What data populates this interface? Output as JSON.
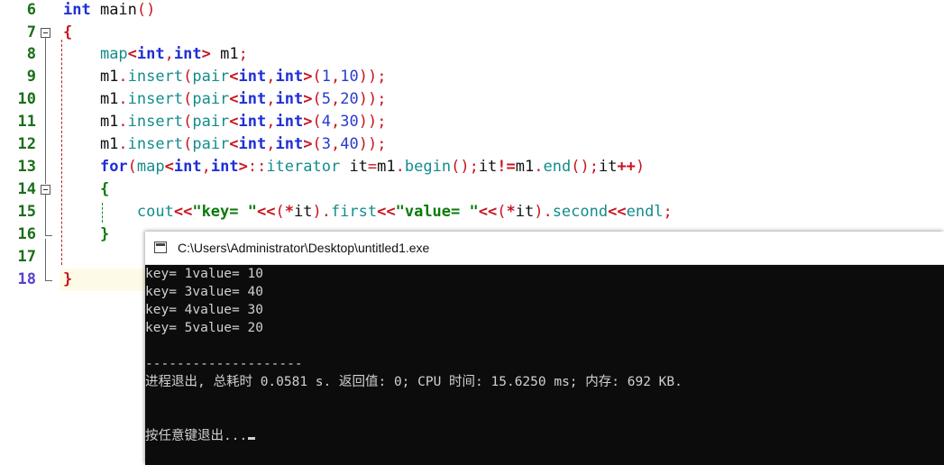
{
  "editor": {
    "line_numbers": [
      "6",
      "7",
      "8",
      "9",
      "10",
      "11",
      "12",
      "13",
      "14",
      "15",
      "16",
      "17",
      "18"
    ],
    "lines": {
      "l6": [
        {
          "c": "kw",
          "t": "int"
        },
        {
          "c": "pl",
          "t": " main"
        },
        {
          "c": "pu",
          "t": "()"
        }
      ],
      "l7": [
        {
          "c": "br",
          "t": "{"
        }
      ],
      "l8": [
        {
          "c": "pl",
          "t": "    "
        },
        {
          "c": "ty",
          "t": "map"
        },
        {
          "c": "op",
          "t": "<"
        },
        {
          "c": "kw",
          "t": "int"
        },
        {
          "c": "pu",
          "t": ","
        },
        {
          "c": "kw",
          "t": "int"
        },
        {
          "c": "op",
          "t": ">"
        },
        {
          "c": "pl",
          "t": " m1"
        },
        {
          "c": "pu",
          "t": ";"
        }
      ],
      "l9": [
        {
          "c": "pl",
          "t": "    m1"
        },
        {
          "c": "pu",
          "t": "."
        },
        {
          "c": "ty",
          "t": "insert"
        },
        {
          "c": "pu",
          "t": "("
        },
        {
          "c": "ty",
          "t": "pair"
        },
        {
          "c": "op",
          "t": "<"
        },
        {
          "c": "kw",
          "t": "int"
        },
        {
          "c": "pu",
          "t": ","
        },
        {
          "c": "kw",
          "t": "int"
        },
        {
          "c": "op",
          "t": ">"
        },
        {
          "c": "pu",
          "t": "("
        },
        {
          "c": "nm",
          "t": "1"
        },
        {
          "c": "pu",
          "t": ","
        },
        {
          "c": "nm",
          "t": "10"
        },
        {
          "c": "pu",
          "t": "));"
        }
      ],
      "l10": [
        {
          "c": "pl",
          "t": "    m1"
        },
        {
          "c": "pu",
          "t": "."
        },
        {
          "c": "ty",
          "t": "insert"
        },
        {
          "c": "pu",
          "t": "("
        },
        {
          "c": "ty",
          "t": "pair"
        },
        {
          "c": "op",
          "t": "<"
        },
        {
          "c": "kw",
          "t": "int"
        },
        {
          "c": "pu",
          "t": ","
        },
        {
          "c": "kw",
          "t": "int"
        },
        {
          "c": "op",
          "t": ">"
        },
        {
          "c": "pu",
          "t": "("
        },
        {
          "c": "nm",
          "t": "5"
        },
        {
          "c": "pu",
          "t": ","
        },
        {
          "c": "nm",
          "t": "20"
        },
        {
          "c": "pu",
          "t": "));"
        }
      ],
      "l11": [
        {
          "c": "pl",
          "t": "    m1"
        },
        {
          "c": "pu",
          "t": "."
        },
        {
          "c": "ty",
          "t": "insert"
        },
        {
          "c": "pu",
          "t": "("
        },
        {
          "c": "ty",
          "t": "pair"
        },
        {
          "c": "op",
          "t": "<"
        },
        {
          "c": "kw",
          "t": "int"
        },
        {
          "c": "pu",
          "t": ","
        },
        {
          "c": "kw",
          "t": "int"
        },
        {
          "c": "op",
          "t": ">"
        },
        {
          "c": "pu",
          "t": "("
        },
        {
          "c": "nm",
          "t": "4"
        },
        {
          "c": "pu",
          "t": ","
        },
        {
          "c": "nm",
          "t": "30"
        },
        {
          "c": "pu",
          "t": "));"
        }
      ],
      "l12": [
        {
          "c": "pl",
          "t": "    m1"
        },
        {
          "c": "pu",
          "t": "."
        },
        {
          "c": "ty",
          "t": "insert"
        },
        {
          "c": "pu",
          "t": "("
        },
        {
          "c": "ty",
          "t": "pair"
        },
        {
          "c": "op",
          "t": "<"
        },
        {
          "c": "kw",
          "t": "int"
        },
        {
          "c": "pu",
          "t": ","
        },
        {
          "c": "kw",
          "t": "int"
        },
        {
          "c": "op",
          "t": ">"
        },
        {
          "c": "pu",
          "t": "("
        },
        {
          "c": "nm",
          "t": "3"
        },
        {
          "c": "pu",
          "t": ","
        },
        {
          "c": "nm",
          "t": "40"
        },
        {
          "c": "pu",
          "t": "));"
        }
      ],
      "l13": [
        {
          "c": "pl",
          "t": "    "
        },
        {
          "c": "kw",
          "t": "for"
        },
        {
          "c": "pu",
          "t": "("
        },
        {
          "c": "ty",
          "t": "map"
        },
        {
          "c": "op",
          "t": "<"
        },
        {
          "c": "kw",
          "t": "int"
        },
        {
          "c": "pu",
          "t": ","
        },
        {
          "c": "kw",
          "t": "int"
        },
        {
          "c": "op",
          "t": ">"
        },
        {
          "c": "pu",
          "t": "::"
        },
        {
          "c": "ty",
          "t": "iterator"
        },
        {
          "c": "pl",
          "t": " it"
        },
        {
          "c": "pu",
          "t": "="
        },
        {
          "c": "pl",
          "t": "m1"
        },
        {
          "c": "pu",
          "t": "."
        },
        {
          "c": "ty",
          "t": "begin"
        },
        {
          "c": "pu",
          "t": "();"
        },
        {
          "c": "pl",
          "t": "it"
        },
        {
          "c": "op",
          "t": "!="
        },
        {
          "c": "pl",
          "t": "m1"
        },
        {
          "c": "pu",
          "t": "."
        },
        {
          "c": "ty",
          "t": "end"
        },
        {
          "c": "pu",
          "t": "();"
        },
        {
          "c": "pl",
          "t": "it"
        },
        {
          "c": "op",
          "t": "++"
        },
        {
          "c": "pu",
          "t": ")"
        }
      ],
      "l14": [
        {
          "c": "pl",
          "t": "    "
        },
        {
          "c": "br2",
          "t": "{"
        }
      ],
      "l15": [
        {
          "c": "pl",
          "t": "        "
        },
        {
          "c": "ty",
          "t": "cout"
        },
        {
          "c": "op",
          "t": "<<"
        },
        {
          "c": "st",
          "t": "\"key= \""
        },
        {
          "c": "op",
          "t": "<<"
        },
        {
          "c": "pu",
          "t": "("
        },
        {
          "c": "op",
          "t": "*"
        },
        {
          "c": "pl",
          "t": "it"
        },
        {
          "c": "pu",
          "t": ")."
        },
        {
          "c": "ty",
          "t": "first"
        },
        {
          "c": "op",
          "t": "<<"
        },
        {
          "c": "st",
          "t": "\"value= \""
        },
        {
          "c": "op",
          "t": "<<"
        },
        {
          "c": "pu",
          "t": "("
        },
        {
          "c": "op",
          "t": "*"
        },
        {
          "c": "pl",
          "t": "it"
        },
        {
          "c": "pu",
          "t": ")."
        },
        {
          "c": "ty",
          "t": "second"
        },
        {
          "c": "op",
          "t": "<<"
        },
        {
          "c": "ty",
          "t": "endl"
        },
        {
          "c": "pu",
          "t": ";"
        }
      ],
      "l16": [
        {
          "c": "pl",
          "t": "    "
        },
        {
          "c": "br2",
          "t": "}"
        }
      ],
      "l17": [],
      "l18": [
        {
          "c": "br",
          "t": "}"
        }
      ]
    }
  },
  "console": {
    "title": "C:\\Users\\Administrator\\Desktop\\untitled1.exe",
    "output": [
      "key= 1value= 10",
      "key= 3value= 40",
      "key= 4value= 30",
      "key= 5value= 20",
      "",
      "--------------------",
      "进程退出, 总耗时 0.0581 s. 返回值: 0; CPU 时间: 15.6250 ms; 内存: 692 KB.",
      "",
      "",
      "按任意键退出..."
    ]
  }
}
